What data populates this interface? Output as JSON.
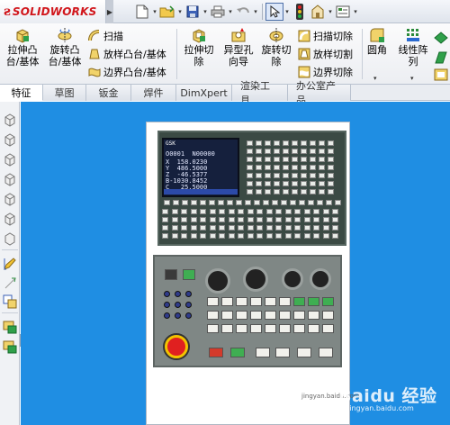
{
  "app": {
    "logo_mark": "ƨ",
    "logo_text": "SOLIDWORKS"
  },
  "colors": {
    "graphics_bg": "#1f8ee3",
    "brand": "#d1161b"
  },
  "quick_access": {
    "icons": [
      "new-document-icon",
      "open-folder-icon",
      "save-icon",
      "print-icon",
      "undo-icon",
      "select-arrow-icon",
      "rebuild-icon",
      "file-properties-icon",
      "options-icon"
    ]
  },
  "ribbon": {
    "extruded_boss": "拉伸凸\n台/基体",
    "revolved_boss": "旋转凸\n台/基体",
    "swept_boss": "扫描",
    "lofted_boss": "放样凸台/基体",
    "boundary_boss": "边界凸台/基体",
    "extruded_cut": "拉伸切\n除",
    "hole_wizard": "异型孔\n向导",
    "revolved_cut": "旋转切\n除",
    "swept_cut": "扫描切除",
    "lofted_cut": "放样切割",
    "boundary_cut": "边界切除",
    "fillet": "圆角",
    "linear_pattern": "线性阵\n列"
  },
  "tabs": [
    {
      "label": "特征",
      "active": true
    },
    {
      "label": "草图",
      "active": false
    },
    {
      "label": "钣金",
      "active": false
    },
    {
      "label": "焊件",
      "active": false
    },
    {
      "label": "DimXpert",
      "active": false
    },
    {
      "label": "渲染工具",
      "active": false
    },
    {
      "label": "办公室产品",
      "active": false
    }
  ],
  "decal_image": {
    "screen_title": "GSK",
    "screen_lines": [
      "O0001  N00000",
      "X  158.0230",
      "Y  486.5000",
      "Z  -46.5377",
      "B-1030.8452",
      "C   25.5000"
    ],
    "copyright": "jingyan.baidu.com"
  },
  "watermark": {
    "main": "Baidu 经验",
    "sub": "jingyan.baidu.com"
  }
}
